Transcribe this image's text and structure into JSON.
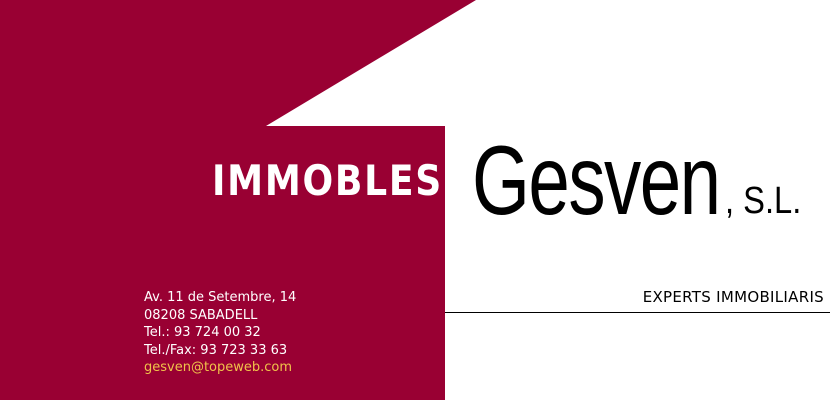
{
  "colors": {
    "brand": "#990033",
    "email": "#f0c24a",
    "text": "#000000"
  },
  "header": {
    "tag": "IMMOBLES"
  },
  "brand": {
    "name": "Gesven",
    "suffix": ", S.L.",
    "slogan": "EXPERTS IMMOBILIARIS"
  },
  "contact": {
    "address": "Av. 11 de Setembre, 14",
    "city": "08208 SABADELL",
    "phone": "Tel.: 93 724 00 32",
    "fax": "Tel./Fax: 93 723 33 63",
    "email": "gesven@topeweb.com"
  }
}
